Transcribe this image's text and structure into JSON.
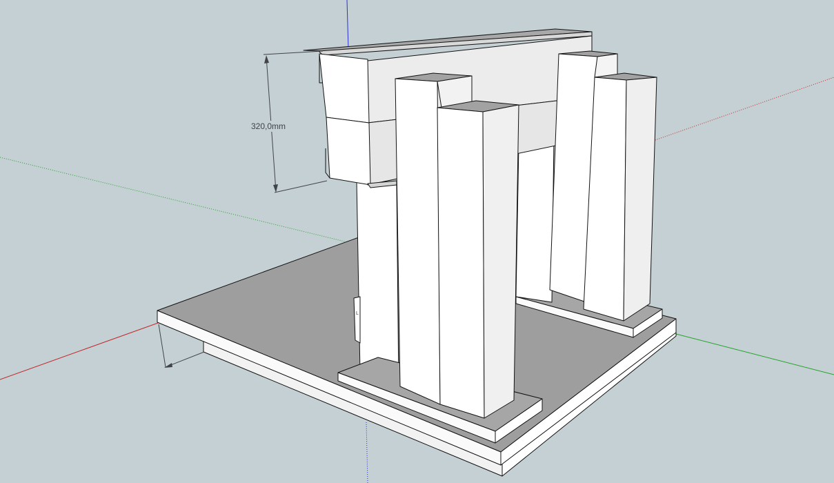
{
  "viewport": {
    "background_color": "#c4d0d3",
    "axes": {
      "red_axis_color": "#c0282a",
      "green_axis_color": "#25a32a",
      "blue_axis_color": "#2a2fd0"
    },
    "dimension": {
      "label": "320,0mm"
    },
    "small_label": "L"
  }
}
